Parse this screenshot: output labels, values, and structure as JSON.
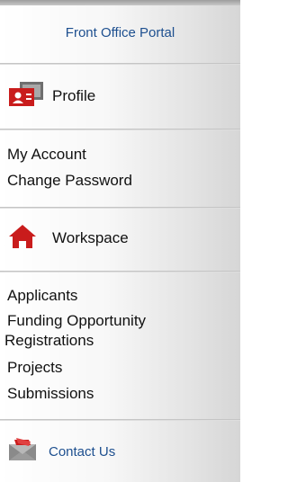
{
  "sidebar": {
    "portal_link": "Front Office Portal",
    "profile": {
      "title": "Profile",
      "icon": "profile-card-icon",
      "links": [
        "My Account",
        "Change Password"
      ]
    },
    "workspace": {
      "title": "Workspace",
      "icon": "home-icon",
      "links": [
        "Applicants",
        "Funding Opportunity",
        "Registrations",
        "Projects",
        "Submissions"
      ]
    },
    "contact": {
      "label": "Contact Us",
      "icon": "envelope-icon"
    }
  },
  "colors": {
    "link_blue": "#1d4f8f",
    "icon_red": "#cc1f1f",
    "icon_gray": "#7a7a7a"
  }
}
